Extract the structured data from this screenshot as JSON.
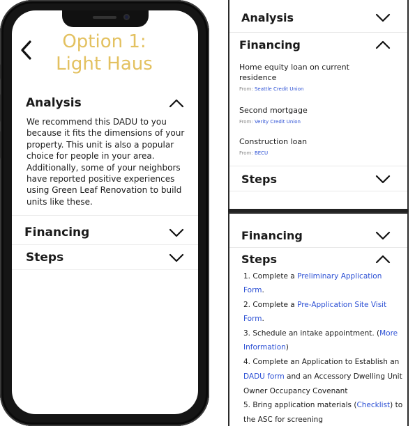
{
  "left_screen": {
    "title_line1": "Option 1:",
    "title_line2": "Light Haus",
    "accent_color": "#e3c160",
    "back_icon": "chevron-left-icon",
    "analysis": {
      "label": "Analysis",
      "lines": [
        "We recommend this DADU to you",
        "because it fits the dimensions of your",
        "property. This unit is also a popular",
        "choice for people in your area.",
        "Additionally, some of your neighbors",
        "have reported positive experiences",
        "using Green Leaf Renovation to build",
        "units like these."
      ]
    },
    "financing": {
      "label": "Financing"
    },
    "steps": {
      "label": "Steps"
    }
  },
  "right_top": {
    "analysis": {
      "label": "Analysis"
    },
    "financing": {
      "label": "Financing",
      "from_prefix": "From: ",
      "items": [
        {
          "line1": "Home equity loan on current",
          "line2": "residence",
          "from": "Seattle Credit Union"
        },
        {
          "line1": "Second mortgage",
          "line2": "",
          "from": "Verity Credit Union"
        },
        {
          "line1": "Construction loan",
          "line2": "",
          "from": "BECU"
        }
      ]
    },
    "steps": {
      "label": "Steps"
    }
  },
  "right_bottom": {
    "financing": {
      "label": "Financing"
    },
    "steps": {
      "label": "Steps",
      "s1a": "1. Complete a ",
      "s1_link_a": "Preliminary Application",
      "s1_link_b": "Form",
      "s1b": ".",
      "s2a": "2. Complete a ",
      "s2_link_a": "Pre-Application Site Visit",
      "s2_link_b": "Form",
      "s2b": ".",
      "s3a": "3. Schedule an intake appointment. (",
      "s3_link_a": "More",
      "s3_link_b": "Information",
      "s3b": ")",
      "s4a": "4. Complete an Application to Establish an",
      "s4_link": "DADU form",
      "s4b": " and an Accessory Dwelling Unit",
      "s4c": "Owner Occupancy Covenant",
      "s5a": "5. Bring application materials (",
      "s5_link": "Checklist",
      "s5b": ") to",
      "s5c": "the ASC for screening"
    }
  },
  "colors": {
    "link": "#2b4fd4",
    "phone_frame": "#151515"
  }
}
